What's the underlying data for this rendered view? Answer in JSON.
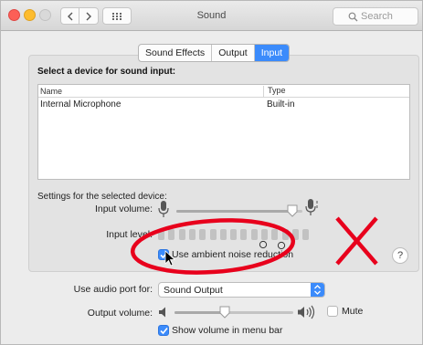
{
  "window": {
    "title": "Sound"
  },
  "search": {
    "placeholder": "Search"
  },
  "tabs": [
    {
      "label": "Sound Effects",
      "active": false
    },
    {
      "label": "Output",
      "active": false
    },
    {
      "label": "Input",
      "active": true
    }
  ],
  "input_section": {
    "heading": "Select a device for sound input:",
    "columns": [
      "Name",
      "Type"
    ],
    "devices": [
      {
        "name": "Internal Microphone",
        "type": "Built-in"
      }
    ]
  },
  "settings": {
    "label": "Settings for the selected device:",
    "input_volume_label": "Input volume:",
    "input_volume_value": 0.92,
    "input_level_label": "Input level:",
    "input_level_segments": 15,
    "ambient_noise_label": "Use ambient noise reduction",
    "ambient_noise_checked": true
  },
  "bottom": {
    "audio_port_label": "Use audio port for:",
    "audio_port_value": "Sound Output",
    "output_volume_label": "Output volume:",
    "output_volume_value": 0.42,
    "mute_label": "Mute",
    "mute_checked": false,
    "show_volume_label": "Show volume in menu bar",
    "show_volume_checked": true
  },
  "help": {
    "label": "?"
  },
  "colors": {
    "accent": "#3b8bfb",
    "annotation": "#e8001c"
  }
}
